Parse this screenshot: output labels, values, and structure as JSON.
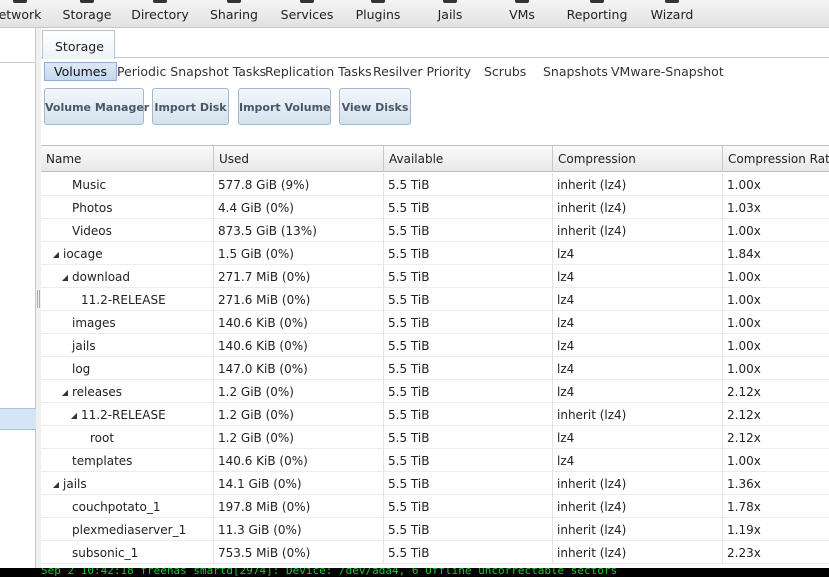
{
  "nav": [
    {
      "label": "etwork",
      "icon": "network-icon"
    },
    {
      "label": "Storage",
      "icon": "storage-icon"
    },
    {
      "label": "Directory",
      "icon": "directory-icon"
    },
    {
      "label": "Sharing",
      "icon": "sharing-icon"
    },
    {
      "label": "Services",
      "icon": "services-icon"
    },
    {
      "label": "Plugins",
      "icon": "plugins-icon"
    },
    {
      "label": "Jails",
      "icon": "jails-icon"
    },
    {
      "label": "VMs",
      "icon": "vms-icon"
    },
    {
      "label": "Reporting",
      "icon": "reporting-icon"
    },
    {
      "label": "Wizard",
      "icon": "wizard-icon"
    }
  ],
  "tab": {
    "label": "Storage"
  },
  "subtabs": [
    {
      "label": "Volumes",
      "active": true
    },
    {
      "label": "Periodic Snapshot Tasks"
    },
    {
      "label": "Replication Tasks"
    },
    {
      "label": "Resilver Priority"
    },
    {
      "label": "Scrubs"
    },
    {
      "label": "Snapshots"
    },
    {
      "label": "VMware-Snapshot"
    }
  ],
  "actions": [
    {
      "label": "Volume Manager"
    },
    {
      "label": "Import Disk"
    },
    {
      "label": "Import Volume"
    },
    {
      "label": "View Disks"
    }
  ],
  "table": {
    "columns": [
      "Name",
      "Used",
      "Available",
      "Compression",
      "Compression Ratio"
    ],
    "rows": [
      {
        "name": "Music",
        "level": 2,
        "expander": "",
        "used": "577.8 GiB (9%)",
        "available": "5.5 TiB",
        "compression": "inherit (lz4)",
        "ratio": "1.00x"
      },
      {
        "name": "Photos",
        "level": 2,
        "expander": "",
        "used": "4.4 GiB (0%)",
        "available": "5.5 TiB",
        "compression": "inherit (lz4)",
        "ratio": "1.03x"
      },
      {
        "name": "Videos",
        "level": 2,
        "expander": "",
        "used": "873.5 GiB (13%)",
        "available": "5.5 TiB",
        "compression": "inherit (lz4)",
        "ratio": "1.00x"
      },
      {
        "name": "iocage",
        "level": 1,
        "expander": "◢",
        "used": "1.5 GiB (0%)",
        "available": "5.5 TiB",
        "compression": "lz4",
        "ratio": "1.84x"
      },
      {
        "name": "download",
        "level": 2,
        "expander": "◢",
        "used": "271.7 MiB (0%)",
        "available": "5.5 TiB",
        "compression": "lz4",
        "ratio": "1.00x"
      },
      {
        "name": "11.2-RELEASE",
        "level": 3,
        "expander": "",
        "used": "271.6 MiB (0%)",
        "available": "5.5 TiB",
        "compression": "lz4",
        "ratio": "1.00x"
      },
      {
        "name": "images",
        "level": 2,
        "expander": "",
        "used": "140.6 KiB (0%)",
        "available": "5.5 TiB",
        "compression": "lz4",
        "ratio": "1.00x"
      },
      {
        "name": "jails",
        "level": 2,
        "expander": "",
        "used": "140.6 KiB (0%)",
        "available": "5.5 TiB",
        "compression": "lz4",
        "ratio": "1.00x"
      },
      {
        "name": "log",
        "level": 2,
        "expander": "",
        "used": "147.0 KiB (0%)",
        "available": "5.5 TiB",
        "compression": "lz4",
        "ratio": "1.00x"
      },
      {
        "name": "releases",
        "level": 2,
        "expander": "◢",
        "used": "1.2 GiB (0%)",
        "available": "5.5 TiB",
        "compression": "lz4",
        "ratio": "2.12x"
      },
      {
        "name": "11.2-RELEASE",
        "level": 3,
        "expander": "◢",
        "used": "1.2 GiB (0%)",
        "available": "5.5 TiB",
        "compression": "inherit (lz4)",
        "ratio": "2.12x"
      },
      {
        "name": "root",
        "level": 4,
        "expander": "",
        "used": "1.2 GiB (0%)",
        "available": "5.5 TiB",
        "compression": "lz4",
        "ratio": "2.12x"
      },
      {
        "name": "templates",
        "level": 2,
        "expander": "",
        "used": "140.6 KiB (0%)",
        "available": "5.5 TiB",
        "compression": "lz4",
        "ratio": "1.00x"
      },
      {
        "name": "jails",
        "level": 1,
        "expander": "◢",
        "used": "14.1 GiB (0%)",
        "available": "5.5 TiB",
        "compression": "inherit (lz4)",
        "ratio": "1.36x"
      },
      {
        "name": "couchpotato_1",
        "level": 2,
        "expander": "",
        "used": "197.8 MiB (0%)",
        "available": "5.5 TiB",
        "compression": "inherit (lz4)",
        "ratio": "1.78x"
      },
      {
        "name": "plexmediaserver_1",
        "level": 2,
        "expander": "",
        "used": "11.3 GiB (0%)",
        "available": "5.5 TiB",
        "compression": "inherit (lz4)",
        "ratio": "1.19x"
      },
      {
        "name": "subsonic_1",
        "level": 2,
        "expander": "",
        "used": "753.5 MiB (0%)",
        "available": "5.5 TiB",
        "compression": "inherit (lz4)",
        "ratio": "2.23x"
      }
    ]
  },
  "status": {
    "text": "Sep  2 10:42:18 freenas smartd[2974]: Device: /dev/ada4, 6 Offline uncorrectable sectors"
  }
}
